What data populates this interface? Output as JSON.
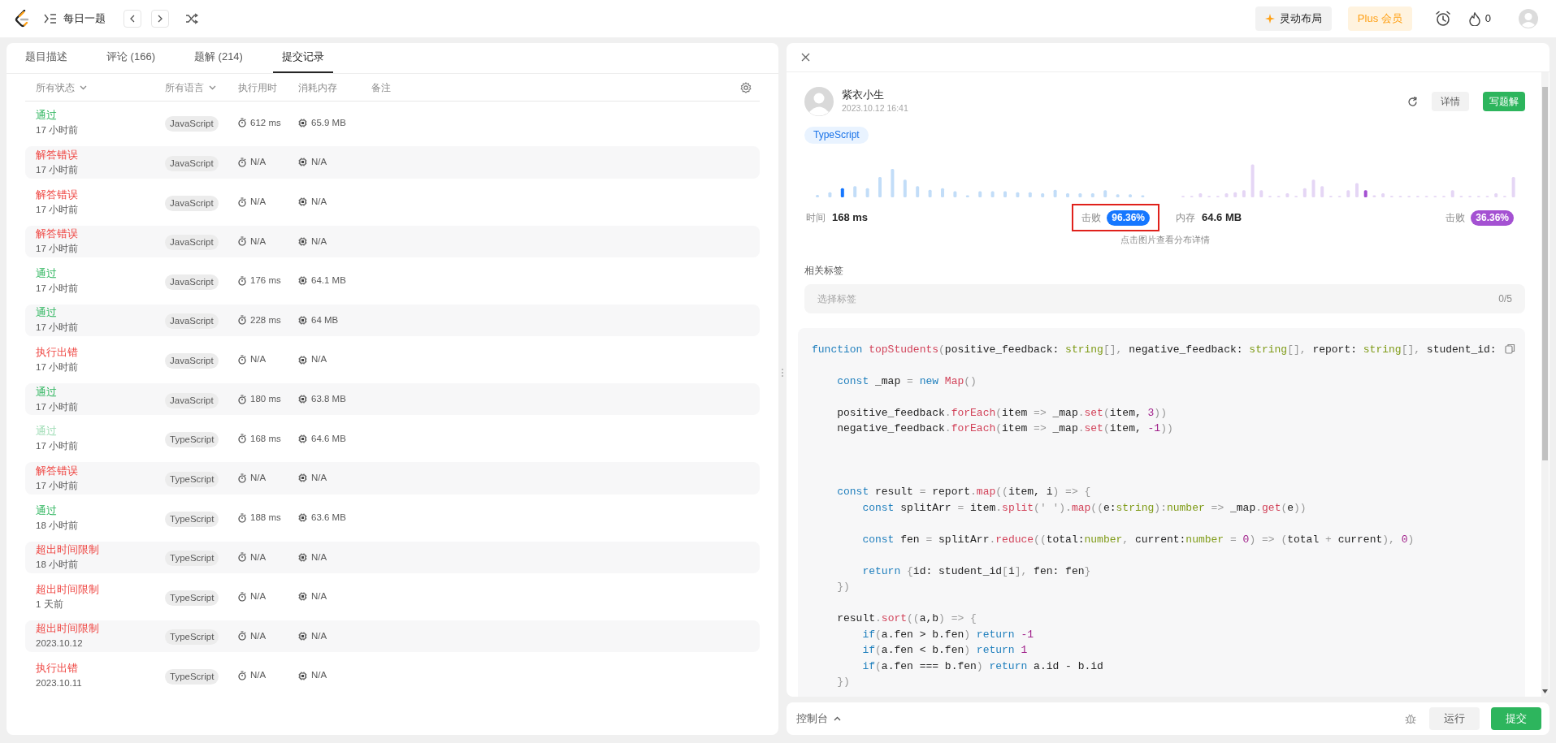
{
  "top_bar": {
    "title": "每日一题",
    "layout_button": "灵动布局",
    "plus_button": "Plus 会员",
    "streak_count": "0"
  },
  "left_panel": {
    "tabs": [
      {
        "label": "题目描述",
        "selected": false
      },
      {
        "label": "评论 (166)",
        "selected": false
      },
      {
        "label": "题解 (214)",
        "selected": false
      },
      {
        "label": "提交记录",
        "selected": true
      }
    ],
    "columns": [
      {
        "label": "所有状态",
        "kind": "filter"
      },
      {
        "label": "所有语言",
        "kind": "filter"
      },
      {
        "label": "执行用时",
        "kind": "sort"
      },
      {
        "label": "消耗内存",
        "kind": "sort"
      },
      {
        "label": "备注",
        "kind": "sort"
      }
    ],
    "rows": [
      {
        "status": "通过",
        "kind": "accepted",
        "time_ago": "17 小时前",
        "language": "JavaScript",
        "runtime": "612 ms",
        "memory": "65.9 MB",
        "selected": false
      },
      {
        "status": "解答错误",
        "kind": "error",
        "time_ago": "17 小时前",
        "language": "JavaScript",
        "runtime": "N/A",
        "memory": "N/A",
        "selected": false
      },
      {
        "status": "解答错误",
        "kind": "error",
        "time_ago": "17 小时前",
        "language": "JavaScript",
        "runtime": "N/A",
        "memory": "N/A",
        "selected": false
      },
      {
        "status": "解答错误",
        "kind": "error",
        "time_ago": "17 小时前",
        "language": "JavaScript",
        "runtime": "N/A",
        "memory": "N/A",
        "selected": false
      },
      {
        "status": "通过",
        "kind": "accepted",
        "time_ago": "17 小时前",
        "language": "JavaScript",
        "runtime": "176 ms",
        "memory": "64.1 MB",
        "selected": false
      },
      {
        "status": "通过",
        "kind": "accepted",
        "time_ago": "17 小时前",
        "language": "JavaScript",
        "runtime": "228 ms",
        "memory": "64 MB",
        "selected": false
      },
      {
        "status": "执行出错",
        "kind": "error",
        "time_ago": "17 小时前",
        "language": "JavaScript",
        "runtime": "N/A",
        "memory": "N/A",
        "selected": false
      },
      {
        "status": "通过",
        "kind": "accepted",
        "time_ago": "17 小时前",
        "language": "JavaScript",
        "runtime": "180 ms",
        "memory": "63.8 MB",
        "selected": false
      },
      {
        "status": "通过",
        "kind": "accepted",
        "time_ago": "17 小时前",
        "language": "TypeScript",
        "runtime": "168 ms",
        "memory": "64.6 MB",
        "selected": true
      },
      {
        "status": "解答错误",
        "kind": "error",
        "time_ago": "17 小时前",
        "language": "TypeScript",
        "runtime": "N/A",
        "memory": "N/A",
        "selected": false
      },
      {
        "status": "通过",
        "kind": "accepted",
        "time_ago": "18 小时前",
        "language": "TypeScript",
        "runtime": "188 ms",
        "memory": "63.6 MB",
        "selected": false
      },
      {
        "status": "超出时间限制",
        "kind": "error",
        "time_ago": "18 小时前",
        "language": "TypeScript",
        "runtime": "N/A",
        "memory": "N/A",
        "selected": false
      },
      {
        "status": "超出时间限制",
        "kind": "error",
        "time_ago": "1 天前",
        "language": "TypeScript",
        "runtime": "N/A",
        "memory": "N/A",
        "selected": false
      },
      {
        "status": "超出时间限制",
        "kind": "error",
        "time_ago": "2023.10.12",
        "language": "TypeScript",
        "runtime": "N/A",
        "memory": "N/A",
        "selected": false
      },
      {
        "status": "执行出错",
        "kind": "error",
        "time_ago": "2023.10.11",
        "language": "TypeScript",
        "runtime": "N/A",
        "memory": "N/A",
        "selected": false
      }
    ]
  },
  "detail": {
    "author": "紫衣小生",
    "submitted": "2023.10.12 16:41",
    "detail_button": "详情",
    "write_button": "写题解",
    "language": "TypeScript",
    "time_label": "时间",
    "time_value": "168 ms",
    "time_beats_label": "击败",
    "time_beats": "96.36%",
    "memory_label": "内存",
    "memory_value": "64.6 MB",
    "memory_beats_label": "击败",
    "memory_beats": "36.36%",
    "hint": "点击图片查看分布详情",
    "tags_label": "相关标签",
    "tags_placeholder": "选择标签",
    "tags_count": "0/5",
    "code_lines": [
      {
        "kind": "code",
        "tokens": [
          {
            "text": "function ",
            "kind": "keyword"
          },
          {
            "text": "topStudents",
            "kind": "function"
          },
          {
            "text": "(",
            "kind": "punct"
          },
          {
            "text": "positive_feedback: ",
            "kind": "plain"
          },
          {
            "text": "string",
            "kind": "type"
          },
          {
            "text": "[], ",
            "kind": "punct"
          },
          {
            "text": "negative_feedback: ",
            "kind": "plain"
          },
          {
            "text": "string",
            "kind": "type"
          },
          {
            "text": "[], ",
            "kind": "punct"
          },
          {
            "text": "report: ",
            "kind": "plain"
          },
          {
            "text": "string",
            "kind": "type"
          },
          {
            "text": "[], ",
            "kind": "punct"
          },
          {
            "text": "student_id:",
            "kind": "plain"
          }
        ]
      },
      {
        "kind": "blank"
      },
      {
        "kind": "code",
        "tokens": [
          {
            "text": "    const ",
            "kind": "keyword"
          },
          {
            "text": "_map ",
            "kind": "plain"
          },
          {
            "text": "= ",
            "kind": "punct"
          },
          {
            "text": "new ",
            "kind": "keyword"
          },
          {
            "text": "Map",
            "kind": "function"
          },
          {
            "text": "()",
            "kind": "punct"
          }
        ]
      },
      {
        "kind": "blank"
      },
      {
        "kind": "code",
        "tokens": [
          {
            "text": "    positive_feedback",
            "kind": "plain"
          },
          {
            "text": ".",
            "kind": "punct"
          },
          {
            "text": "forEach",
            "kind": "function"
          },
          {
            "text": "(",
            "kind": "punct"
          },
          {
            "text": "item ",
            "kind": "plain"
          },
          {
            "text": "=> ",
            "kind": "punct"
          },
          {
            "text": "_map",
            "kind": "plain"
          },
          {
            "text": ".",
            "kind": "punct"
          },
          {
            "text": "set",
            "kind": "function"
          },
          {
            "text": "(",
            "kind": "punct"
          },
          {
            "text": "item, ",
            "kind": "plain"
          },
          {
            "text": "3",
            "kind": "number"
          },
          {
            "text": "))",
            "kind": "punct"
          }
        ]
      },
      {
        "kind": "code",
        "tokens": [
          {
            "text": "    negative_feedback",
            "kind": "plain"
          },
          {
            "text": ".",
            "kind": "punct"
          },
          {
            "text": "forEach",
            "kind": "function"
          },
          {
            "text": "(",
            "kind": "punct"
          },
          {
            "text": "item ",
            "kind": "plain"
          },
          {
            "text": "=> ",
            "kind": "punct"
          },
          {
            "text": "_map",
            "kind": "plain"
          },
          {
            "text": ".",
            "kind": "punct"
          },
          {
            "text": "set",
            "kind": "function"
          },
          {
            "text": "(",
            "kind": "punct"
          },
          {
            "text": "item, ",
            "kind": "plain"
          },
          {
            "text": "-1",
            "kind": "number"
          },
          {
            "text": "))",
            "kind": "punct"
          }
        ]
      },
      {
        "kind": "blank"
      },
      {
        "kind": "blank"
      },
      {
        "kind": "blank"
      },
      {
        "kind": "code",
        "tokens": [
          {
            "text": "    const ",
            "kind": "keyword"
          },
          {
            "text": "result ",
            "kind": "plain"
          },
          {
            "text": "= ",
            "kind": "punct"
          },
          {
            "text": "report",
            "kind": "plain"
          },
          {
            "text": ".",
            "kind": "punct"
          },
          {
            "text": "map",
            "kind": "function"
          },
          {
            "text": "((",
            "kind": "punct"
          },
          {
            "text": "item, i",
            "kind": "plain"
          },
          {
            "text": ") => {",
            "kind": "punct"
          }
        ]
      },
      {
        "kind": "code",
        "tokens": [
          {
            "text": "        const ",
            "kind": "keyword"
          },
          {
            "text": "splitArr ",
            "kind": "plain"
          },
          {
            "text": "= ",
            "kind": "punct"
          },
          {
            "text": "item",
            "kind": "plain"
          },
          {
            "text": ".",
            "kind": "punct"
          },
          {
            "text": "split",
            "kind": "function"
          },
          {
            "text": "(' ')",
            "kind": "punct"
          },
          {
            "text": ".",
            "kind": "punct"
          },
          {
            "text": "map",
            "kind": "function"
          },
          {
            "text": "((",
            "kind": "punct"
          },
          {
            "text": "e:",
            "kind": "plain"
          },
          {
            "text": "string",
            "kind": "type"
          },
          {
            "text": "):",
            "kind": "punct"
          },
          {
            "text": "number",
            "kind": "type"
          },
          {
            "text": " => ",
            "kind": "punct"
          },
          {
            "text": "_map",
            "kind": "plain"
          },
          {
            "text": ".",
            "kind": "punct"
          },
          {
            "text": "get",
            "kind": "function"
          },
          {
            "text": "(",
            "kind": "punct"
          },
          {
            "text": "e",
            "kind": "plain"
          },
          {
            "text": "))",
            "kind": "punct"
          }
        ]
      },
      {
        "kind": "blank"
      },
      {
        "kind": "code",
        "tokens": [
          {
            "text": "        const ",
            "kind": "keyword"
          },
          {
            "text": "fen ",
            "kind": "plain"
          },
          {
            "text": "= ",
            "kind": "punct"
          },
          {
            "text": "splitArr",
            "kind": "plain"
          },
          {
            "text": ".",
            "kind": "punct"
          },
          {
            "text": "reduce",
            "kind": "function"
          },
          {
            "text": "((",
            "kind": "punct"
          },
          {
            "text": "total:",
            "kind": "plain"
          },
          {
            "text": "number",
            "kind": "type"
          },
          {
            "text": ", ",
            "kind": "punct"
          },
          {
            "text": "current:",
            "kind": "plain"
          },
          {
            "text": "number",
            "kind": "type"
          },
          {
            "text": " = ",
            "kind": "punct"
          },
          {
            "text": "0",
            "kind": "number"
          },
          {
            "text": ") => (",
            "kind": "punct"
          },
          {
            "text": "total ",
            "kind": "plain"
          },
          {
            "text": "+ ",
            "kind": "punct"
          },
          {
            "text": "current",
            "kind": "plain"
          },
          {
            "text": "), ",
            "kind": "punct"
          },
          {
            "text": "0",
            "kind": "number"
          },
          {
            "text": ")",
            "kind": "punct"
          }
        ]
      },
      {
        "kind": "blank"
      },
      {
        "kind": "code",
        "tokens": [
          {
            "text": "        return ",
            "kind": "keyword"
          },
          {
            "text": "{",
            "kind": "punct"
          },
          {
            "text": "id: student_id",
            "kind": "plain"
          },
          {
            "text": "[",
            "kind": "punct"
          },
          {
            "text": "i",
            "kind": "plain"
          },
          {
            "text": "], ",
            "kind": "punct"
          },
          {
            "text": "fen: fen",
            "kind": "plain"
          },
          {
            "text": "}",
            "kind": "punct"
          }
        ]
      },
      {
        "kind": "code",
        "tokens": [
          {
            "text": "    })",
            "kind": "punct"
          }
        ]
      },
      {
        "kind": "blank"
      },
      {
        "kind": "code",
        "tokens": [
          {
            "text": "    result",
            "kind": "plain"
          },
          {
            "text": ".",
            "kind": "punct"
          },
          {
            "text": "sort",
            "kind": "function"
          },
          {
            "text": "((",
            "kind": "punct"
          },
          {
            "text": "a,b",
            "kind": "plain"
          },
          {
            "text": ") => {",
            "kind": "punct"
          }
        ]
      },
      {
        "kind": "code",
        "tokens": [
          {
            "text": "        if",
            "kind": "keyword"
          },
          {
            "text": "(",
            "kind": "punct"
          },
          {
            "text": "a.fen > b.fen",
            "kind": "plain"
          },
          {
            "text": ") ",
            "kind": "punct"
          },
          {
            "text": "return ",
            "kind": "keyword"
          },
          {
            "text": "-1",
            "kind": "number"
          }
        ]
      },
      {
        "kind": "code",
        "tokens": [
          {
            "text": "        if",
            "kind": "keyword"
          },
          {
            "text": "(",
            "kind": "punct"
          },
          {
            "text": "a.fen < b.fen",
            "kind": "plain"
          },
          {
            "text": ") ",
            "kind": "punct"
          },
          {
            "text": "return ",
            "kind": "keyword"
          },
          {
            "text": "1",
            "kind": "number"
          }
        ]
      },
      {
        "kind": "code",
        "tokens": [
          {
            "text": "        if",
            "kind": "keyword"
          },
          {
            "text": "(",
            "kind": "punct"
          },
          {
            "text": "a.fen === b.fen",
            "kind": "plain"
          },
          {
            "text": ") ",
            "kind": "punct"
          },
          {
            "text": "return ",
            "kind": "keyword"
          },
          {
            "text": "a.id - b.id",
            "kind": "plain"
          }
        ]
      },
      {
        "kind": "code",
        "tokens": [
          {
            "text": "    })",
            "kind": "punct"
          }
        ]
      }
    ]
  },
  "console": {
    "label": "控制台",
    "run_button": "运行",
    "submit_button": "提交"
  }
}
